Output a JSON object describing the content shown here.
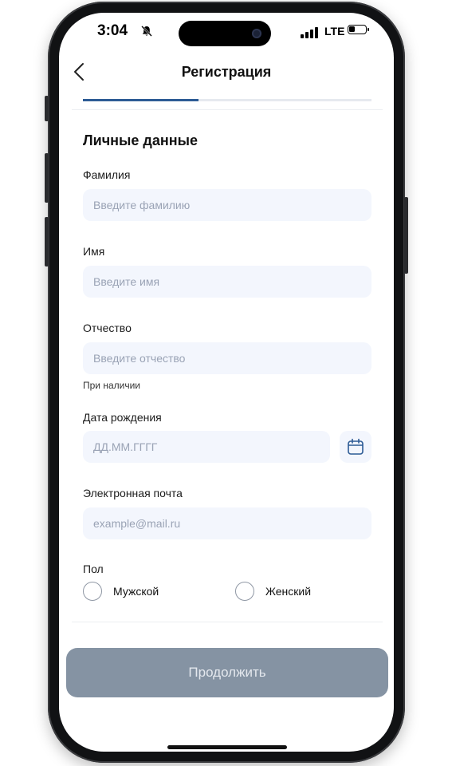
{
  "status_bar": {
    "time": "3:04",
    "network": "LTE",
    "icons": [
      "bell-muted-icon",
      "signal-icon",
      "battery-icon"
    ]
  },
  "header": {
    "title": "Регистрация",
    "back_icon": "chevron-left-icon"
  },
  "progress": {
    "step": 1,
    "total": 3,
    "fraction": 0.4
  },
  "form": {
    "section_title": "Личные данные",
    "last_name": {
      "label": "Фамилия",
      "placeholder": "Введите фамилию"
    },
    "first_name": {
      "label": "Имя",
      "placeholder": "Введите имя"
    },
    "middle_name": {
      "label": "Отчество",
      "placeholder": "Введите отчество",
      "hint": "При наличии"
    },
    "birth_date": {
      "label": "Дата рождения",
      "placeholder": "ДД.ММ.ГГГГ",
      "icon": "calendar-icon"
    },
    "email": {
      "label": "Электронная почта",
      "placeholder": "example@mail.ru"
    },
    "gender": {
      "label": "Пол",
      "options": [
        {
          "label": "Мужской",
          "selected": false
        },
        {
          "label": "Женский",
          "selected": false
        }
      ]
    }
  },
  "actions": {
    "continue_label": "Продолжить"
  },
  "colors": {
    "accent": "#2d5b95",
    "field_background": "#f3f6fd",
    "button_disabled": "#8593a3",
    "placeholder": "#9aa3b5"
  }
}
